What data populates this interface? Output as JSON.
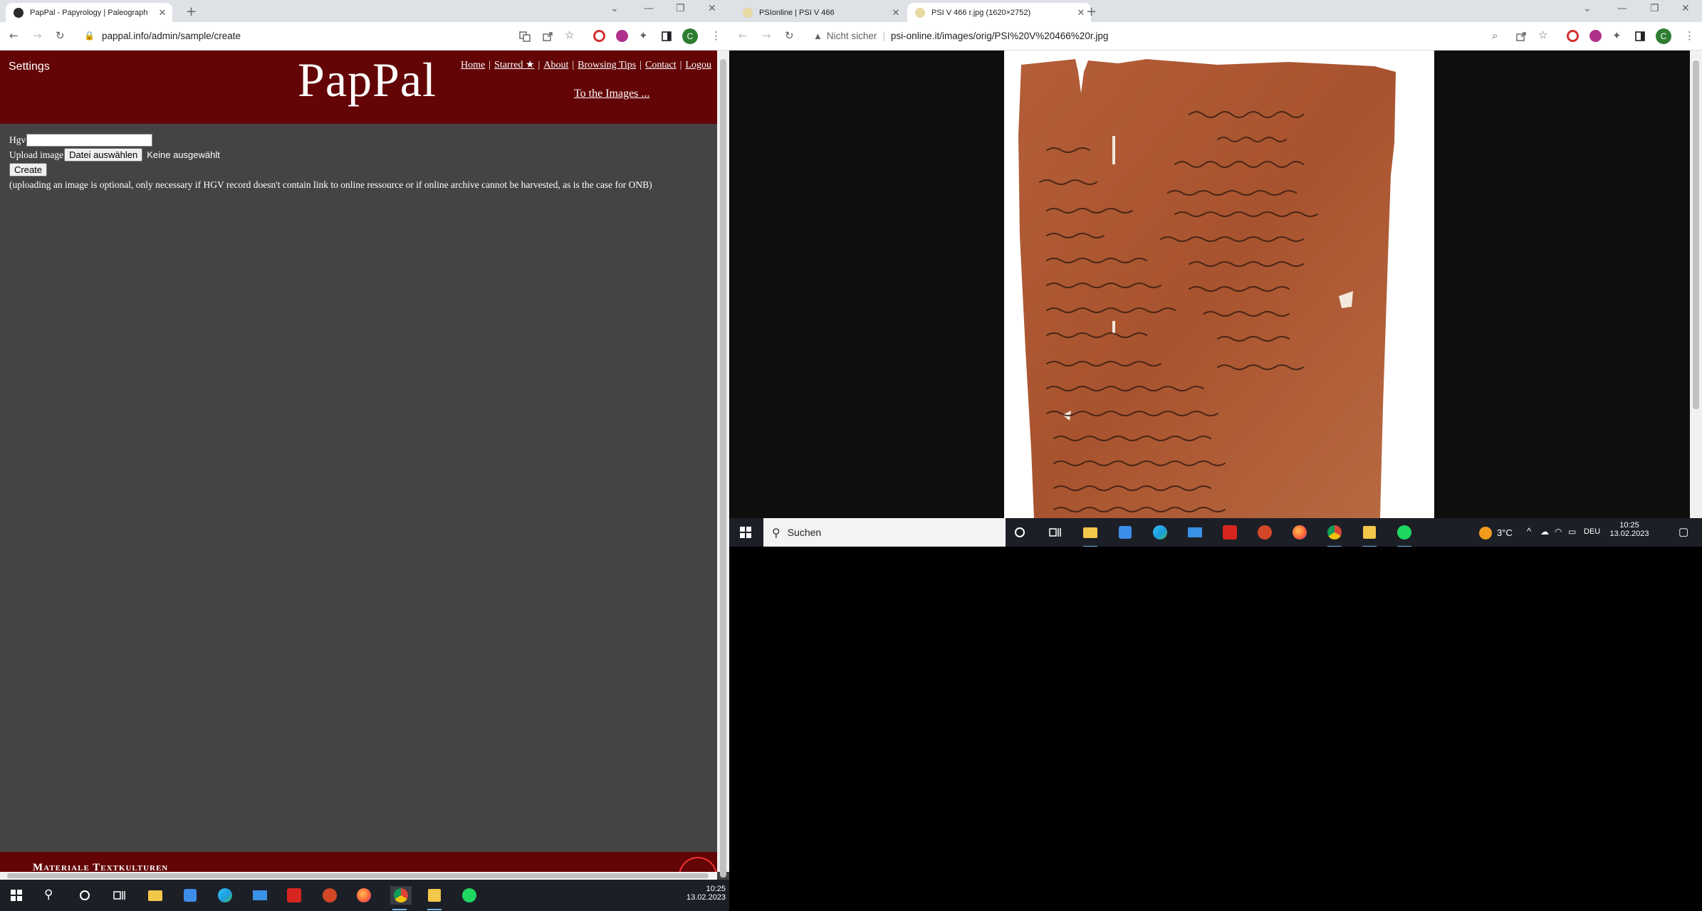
{
  "left_browser": {
    "tab_title": "PapPal - Papyrology | Paleograph",
    "url": "pappal.info/admin/sample/create",
    "profile_letter": "C"
  },
  "pappal": {
    "settings_label": "Settings",
    "logo": "PapPal",
    "nav": {
      "home": "Home",
      "starred": "Starred ★",
      "about": "About",
      "browsing_tips": "Browsing Tips",
      "contact": "Contact",
      "logout": "Logou"
    },
    "to_images": "To the Images ...",
    "form": {
      "hgv_label": "Hgv",
      "hgv_value": "",
      "upload_label": "Upload image",
      "file_button": "Datei auswählen",
      "file_status": "Keine ausgewählt",
      "create_button": "Create",
      "note": "(uploading an image is optional, only necessary if HGV record doesn't contain link to online ressource or if online archive cannot be harvested, as is the case for ONB)"
    },
    "footer_text": "Materiale Textkulturen"
  },
  "right_browser": {
    "tabs": [
      {
        "title": "PSIonline | PSI V 466",
        "active": false
      },
      {
        "title": "PSI V 466 r.jpg (1620×2752)",
        "active": true
      }
    ],
    "security_label": "Nicht sicher",
    "url": "psi-online.it/images/orig/PSI%20V%20466%20r.jpg",
    "profile_letter": "C"
  },
  "right_taskbar": {
    "search_placeholder": "Suchen",
    "weather": "3°C",
    "language": "DEU",
    "time": "10:25",
    "date": "13.02.2023"
  },
  "left_taskbar": {
    "time": "10:25",
    "date": "13.02.2023"
  },
  "colors": {
    "pappal_red": "#630506",
    "page_bg": "#444444",
    "papyrus": "#b5623a"
  }
}
